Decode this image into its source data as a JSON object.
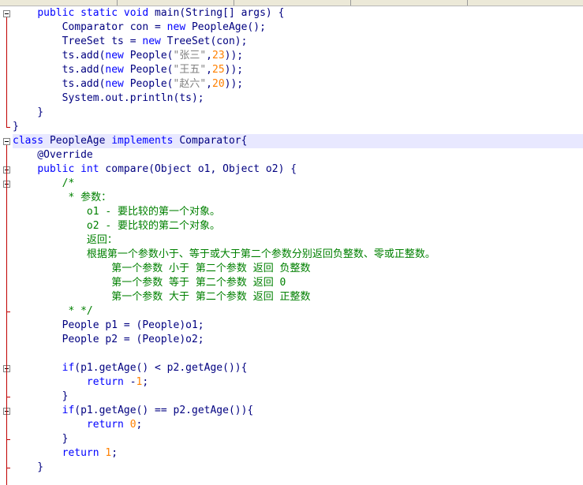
{
  "lines": [
    {
      "hl": false,
      "tokens": [
        {
          "t": "    "
        },
        {
          "t": "public static void",
          "c": "kw"
        },
        {
          "t": " main(String[] args) {"
        }
      ]
    },
    {
      "hl": false,
      "tokens": [
        {
          "t": "        Comparator con = "
        },
        {
          "t": "new",
          "c": "kw"
        },
        {
          "t": " PeopleAge();"
        }
      ]
    },
    {
      "hl": false,
      "tokens": [
        {
          "t": "        TreeSet ts = "
        },
        {
          "t": "new",
          "c": "kw"
        },
        {
          "t": " TreeSet(con);"
        }
      ]
    },
    {
      "hl": false,
      "tokens": [
        {
          "t": "        ts.add("
        },
        {
          "t": "new",
          "c": "kw"
        },
        {
          "t": " People("
        },
        {
          "t": "\"张三\"",
          "c": "str"
        },
        {
          "t": ","
        },
        {
          "t": "23",
          "c": "num"
        },
        {
          "t": "));"
        }
      ]
    },
    {
      "hl": false,
      "tokens": [
        {
          "t": "        ts.add("
        },
        {
          "t": "new",
          "c": "kw"
        },
        {
          "t": " People("
        },
        {
          "t": "\"王五\"",
          "c": "str"
        },
        {
          "t": ","
        },
        {
          "t": "25",
          "c": "num"
        },
        {
          "t": "));"
        }
      ]
    },
    {
      "hl": false,
      "tokens": [
        {
          "t": "        ts.add("
        },
        {
          "t": "new",
          "c": "kw"
        },
        {
          "t": " People("
        },
        {
          "t": "\"赵六\"",
          "c": "str"
        },
        {
          "t": ","
        },
        {
          "t": "20",
          "c": "num"
        },
        {
          "t": "));"
        }
      ]
    },
    {
      "hl": false,
      "tokens": [
        {
          "t": "        System.out.println(ts);"
        }
      ]
    },
    {
      "hl": false,
      "tokens": [
        {
          "t": "    }"
        }
      ]
    },
    {
      "hl": false,
      "tokens": [
        {
          "t": "}"
        }
      ]
    },
    {
      "hl": true,
      "tokens": [
        {
          "t": "class",
          "c": "kw"
        },
        {
          "t": " PeopleAge "
        },
        {
          "t": "implements",
          "c": "kw"
        },
        {
          "t": " Comparator{"
        }
      ]
    },
    {
      "hl": false,
      "tokens": [
        {
          "t": "    @Override",
          "c": "ann"
        }
      ]
    },
    {
      "hl": false,
      "tokens": [
        {
          "t": "    "
        },
        {
          "t": "public int",
          "c": "kw"
        },
        {
          "t": " compare(Object o1, Object o2) {"
        }
      ]
    },
    {
      "hl": false,
      "tokens": [
        {
          "t": "        /*",
          "c": "cm"
        }
      ]
    },
    {
      "hl": false,
      "tokens": [
        {
          "t": "         * 参数：",
          "c": "cm"
        }
      ]
    },
    {
      "hl": false,
      "tokens": [
        {
          "t": "            o1 - 要比较的第一个对象。",
          "c": "cm"
        }
      ]
    },
    {
      "hl": false,
      "tokens": [
        {
          "t": "            o2 - 要比较的第二个对象。",
          "c": "cm"
        }
      ]
    },
    {
      "hl": false,
      "tokens": [
        {
          "t": "            返回：",
          "c": "cm"
        }
      ]
    },
    {
      "hl": false,
      "tokens": [
        {
          "t": "            根据第一个参数小于、等于或大于第二个参数分别返回负整数、零或正整数。",
          "c": "cm"
        }
      ]
    },
    {
      "hl": false,
      "tokens": [
        {
          "t": "                第一个参数 小于 第二个参数 返回 负整数",
          "c": "cm"
        }
      ]
    },
    {
      "hl": false,
      "tokens": [
        {
          "t": "                第一个参数 等于 第二个参数 返回 0",
          "c": "cm"
        }
      ]
    },
    {
      "hl": false,
      "tokens": [
        {
          "t": "                第一个参数 大于 第二个参数 返回 正整数",
          "c": "cm"
        }
      ]
    },
    {
      "hl": false,
      "tokens": [
        {
          "t": "         * */",
          "c": "cm"
        }
      ]
    },
    {
      "hl": false,
      "tokens": [
        {
          "t": "        People p1 = (People)o1;"
        }
      ]
    },
    {
      "hl": false,
      "tokens": [
        {
          "t": "        People p2 = (People)o2;"
        }
      ]
    },
    {
      "hl": false,
      "tokens": [
        {
          "t": ""
        }
      ]
    },
    {
      "hl": false,
      "tokens": [
        {
          "t": "        "
        },
        {
          "t": "if",
          "c": "kw"
        },
        {
          "t": "(p1.getAge() < p2.getAge()){"
        }
      ]
    },
    {
      "hl": false,
      "tokens": [
        {
          "t": "            "
        },
        {
          "t": "return",
          "c": "kw"
        },
        {
          "t": " -"
        },
        {
          "t": "1",
          "c": "num"
        },
        {
          "t": ";"
        }
      ]
    },
    {
      "hl": false,
      "tokens": [
        {
          "t": "        }"
        }
      ]
    },
    {
      "hl": false,
      "tokens": [
        {
          "t": "        "
        },
        {
          "t": "if",
          "c": "kw"
        },
        {
          "t": "(p1.getAge() == p2.getAge()){"
        }
      ]
    },
    {
      "hl": false,
      "tokens": [
        {
          "t": "            "
        },
        {
          "t": "return",
          "c": "kw"
        },
        {
          "t": " "
        },
        {
          "t": "0",
          "c": "num"
        },
        {
          "t": ";"
        }
      ]
    },
    {
      "hl": false,
      "tokens": [
        {
          "t": "        }"
        }
      ]
    },
    {
      "hl": false,
      "tokens": [
        {
          "t": "        "
        },
        {
          "t": "return",
          "c": "kw"
        },
        {
          "t": " "
        },
        {
          "t": "1",
          "c": "num"
        },
        {
          "t": ";"
        }
      ]
    },
    {
      "hl": false,
      "tokens": [
        {
          "t": "    }"
        }
      ]
    }
  ],
  "fold_rows": [
    0,
    9,
    11,
    12,
    25,
    28
  ],
  "colors": {
    "keyword": "#0000ff",
    "text": "#000080",
    "comment": "#008000",
    "number": "#ff8000",
    "string": "#808080",
    "highlight": "#e8e8ff",
    "fold_line": "#c00000"
  }
}
